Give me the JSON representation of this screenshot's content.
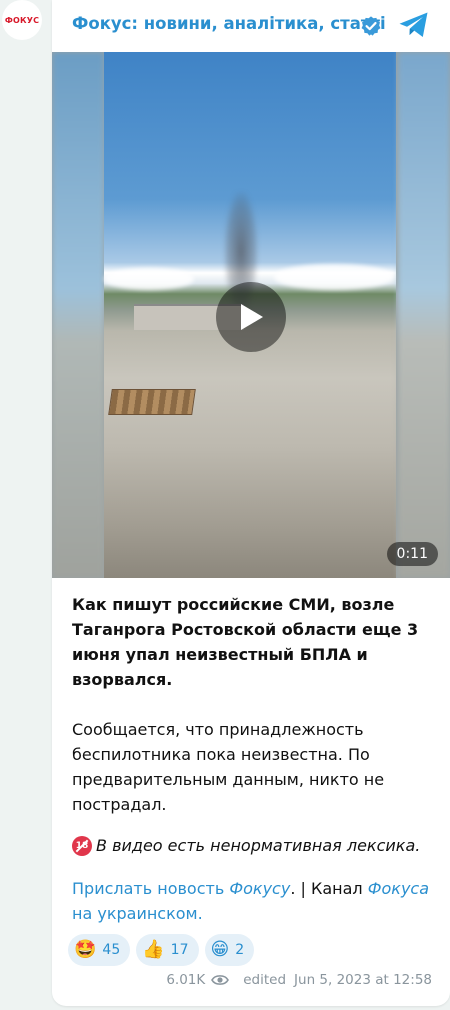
{
  "avatar": {
    "label": "ФОКУС"
  },
  "header": {
    "channel_name": "Фокус: новини, аналітика, статті"
  },
  "video": {
    "duration": "0:11"
  },
  "post": {
    "headline": "Как пишут российские СМИ, возле Таганрога Ростовской области еще 3 июня упал неизвестный БПЛА и взорвался.",
    "body": "Сообщается, что принадлежность беспилотника пока неизвестна. По предварительным данным, никто не пострадал.",
    "warning": "В видео есть ненормативная лексика.",
    "links": {
      "part1": "Прислать новость ",
      "part2_italic": "Фокусу",
      "part3": ". | Канал ",
      "part4_italic": "Фокуса",
      "part5": " на украинском."
    }
  },
  "reactions": [
    {
      "emoji": "🤩",
      "count": "45"
    },
    {
      "emoji": "👍",
      "count": "17"
    },
    {
      "emoji": "😁",
      "count": "2"
    }
  ],
  "footer": {
    "views": "6.01K",
    "edited": "edited",
    "timestamp": "Jun 5, 2023 at 12:58"
  },
  "colors": {
    "accent": "#2a8fcf",
    "brand_red": "#d8192a",
    "background": "#eef3f2"
  },
  "icons": [
    "verified-badge-icon",
    "telegram-logo-icon",
    "play-icon",
    "adult-content-icon",
    "eye-icon"
  ]
}
